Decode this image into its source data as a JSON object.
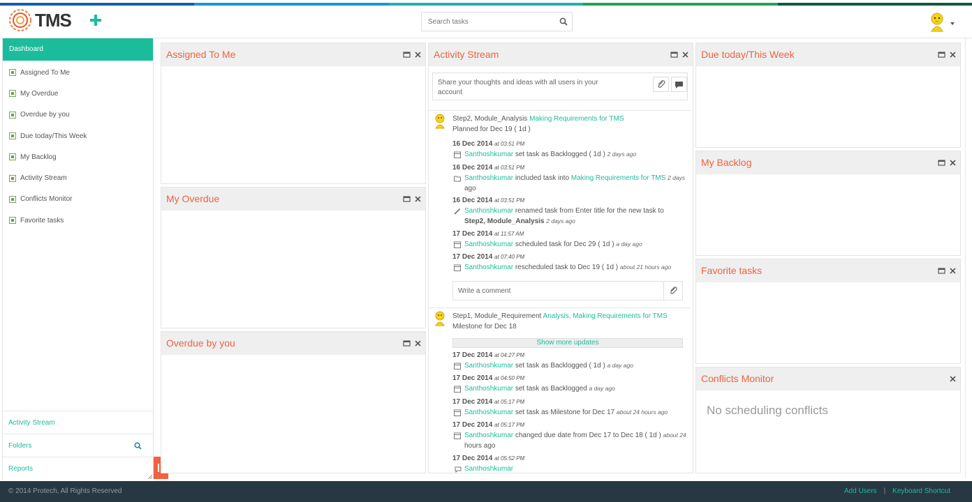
{
  "brand": {
    "name": "TMS",
    "stripe_colors": [
      "#0f5fa8",
      "#139ad6",
      "#1bb3a9",
      "#23a35a",
      "#0d7a3d"
    ]
  },
  "search": {
    "placeholder": "Search tasks"
  },
  "sidebar": {
    "active": "Dashboard",
    "items": [
      {
        "label": "Assigned To Me"
      },
      {
        "label": "My Overdue"
      },
      {
        "label": "Overdue by you"
      },
      {
        "label": "Due today/This Week"
      },
      {
        "label": "My Backlog"
      },
      {
        "label": "Activity Stream"
      },
      {
        "label": "Conflicts Monitor"
      },
      {
        "label": "Favorite tasks"
      }
    ],
    "bottom_links": {
      "activity": "Activity Stream",
      "folders": "Folders",
      "reports": "Reports"
    }
  },
  "panels": {
    "assigned": "Assigned To Me",
    "overdue": "My Overdue",
    "overdue_by_you": "Overdue by you",
    "activity": "Activity Stream",
    "due": "Due today/This Week",
    "backlog": "My Backlog",
    "favorite": "Favorite tasks",
    "conflicts": "Conflicts Monitor"
  },
  "activity": {
    "share_placeholder": "Share your thoughts and ideas with all users in your account",
    "task1": {
      "name": "Step2, Module_Analysis",
      "link": "Making Requirements for TMS",
      "plan": "Planned for Dec 19 ( 1d )",
      "entries": [
        {
          "date": "16 Dec 2014",
          "time": "at 03:51 PM",
          "user": "Santhoshkumar",
          "text": "set task as Backlogged ( 1d )",
          "when": "2 days ago"
        },
        {
          "date": "16 Dec 2014",
          "time": "at 03:51 PM",
          "user": "Santhoshkumar",
          "text": "included task into",
          "link": "Making Requirements for TMS",
          "when": "2 days",
          "when2": "ago"
        },
        {
          "date": "16 Dec 2014",
          "time": "at 03:51 PM",
          "user": "Santhoshkumar",
          "text": "renamed task from Enter title for the new task to",
          "bold": "Step2, Module_Analysis",
          "when": "2 days ago"
        },
        {
          "date": "17 Dec 2014",
          "time": "at 11:57 AM",
          "user": "Santhoshkumar",
          "text": "scheduled task for Dec 29 ( 1d )",
          "when": "a day ago"
        },
        {
          "date": "17 Dec 2014",
          "time": "at 07:40 PM",
          "user": "Santhoshkumar",
          "text": "rescheduled task to Dec 19 ( 1d )",
          "when": "about 21 hours ago"
        }
      ],
      "comment_placeholder": "Write a comment"
    },
    "task2": {
      "name": "Step1, Module_Requirement",
      "link1": "Analysis,",
      "link2": "Making Requirements for TMS",
      "plan": "Milestone for Dec 18",
      "show_more": "Show more updates",
      "entries": [
        {
          "date": "17 Dec 2014",
          "time": "at 04:27 PM",
          "user": "Santhoshkumar",
          "text": "set task as Backlogged ( 1d )",
          "when": "a day ago"
        },
        {
          "date": "17 Dec 2014",
          "time": "at 04:50 PM",
          "user": "Santhoshkumar",
          "text": "set task as Backlogged",
          "when": "a day ago"
        },
        {
          "date": "17 Dec 2014",
          "time": "at 05:17 PM",
          "user": "Santhoshkumar",
          "text": "set task as Milestone for Dec 17",
          "when": "about 24 hours ago"
        },
        {
          "date": "17 Dec 2014",
          "time": "at 05:17 PM",
          "user": "Santhoshkumar",
          "text": "changed due date from Dec 17 to Dec 18 ( 1d )",
          "when": "about 24",
          "when2": "hours ago"
        },
        {
          "date": "17 Dec 2014",
          "time": "at 05:52 PM",
          "user": "Santhoshkumar"
        }
      ]
    }
  },
  "conflicts": {
    "empty": "No scheduling conflicts"
  },
  "footer": {
    "copyright": "© 2014 Protech, All Rights Reserved",
    "add_users": "Add Users",
    "keyboard": "Keyboard Shortcut"
  }
}
